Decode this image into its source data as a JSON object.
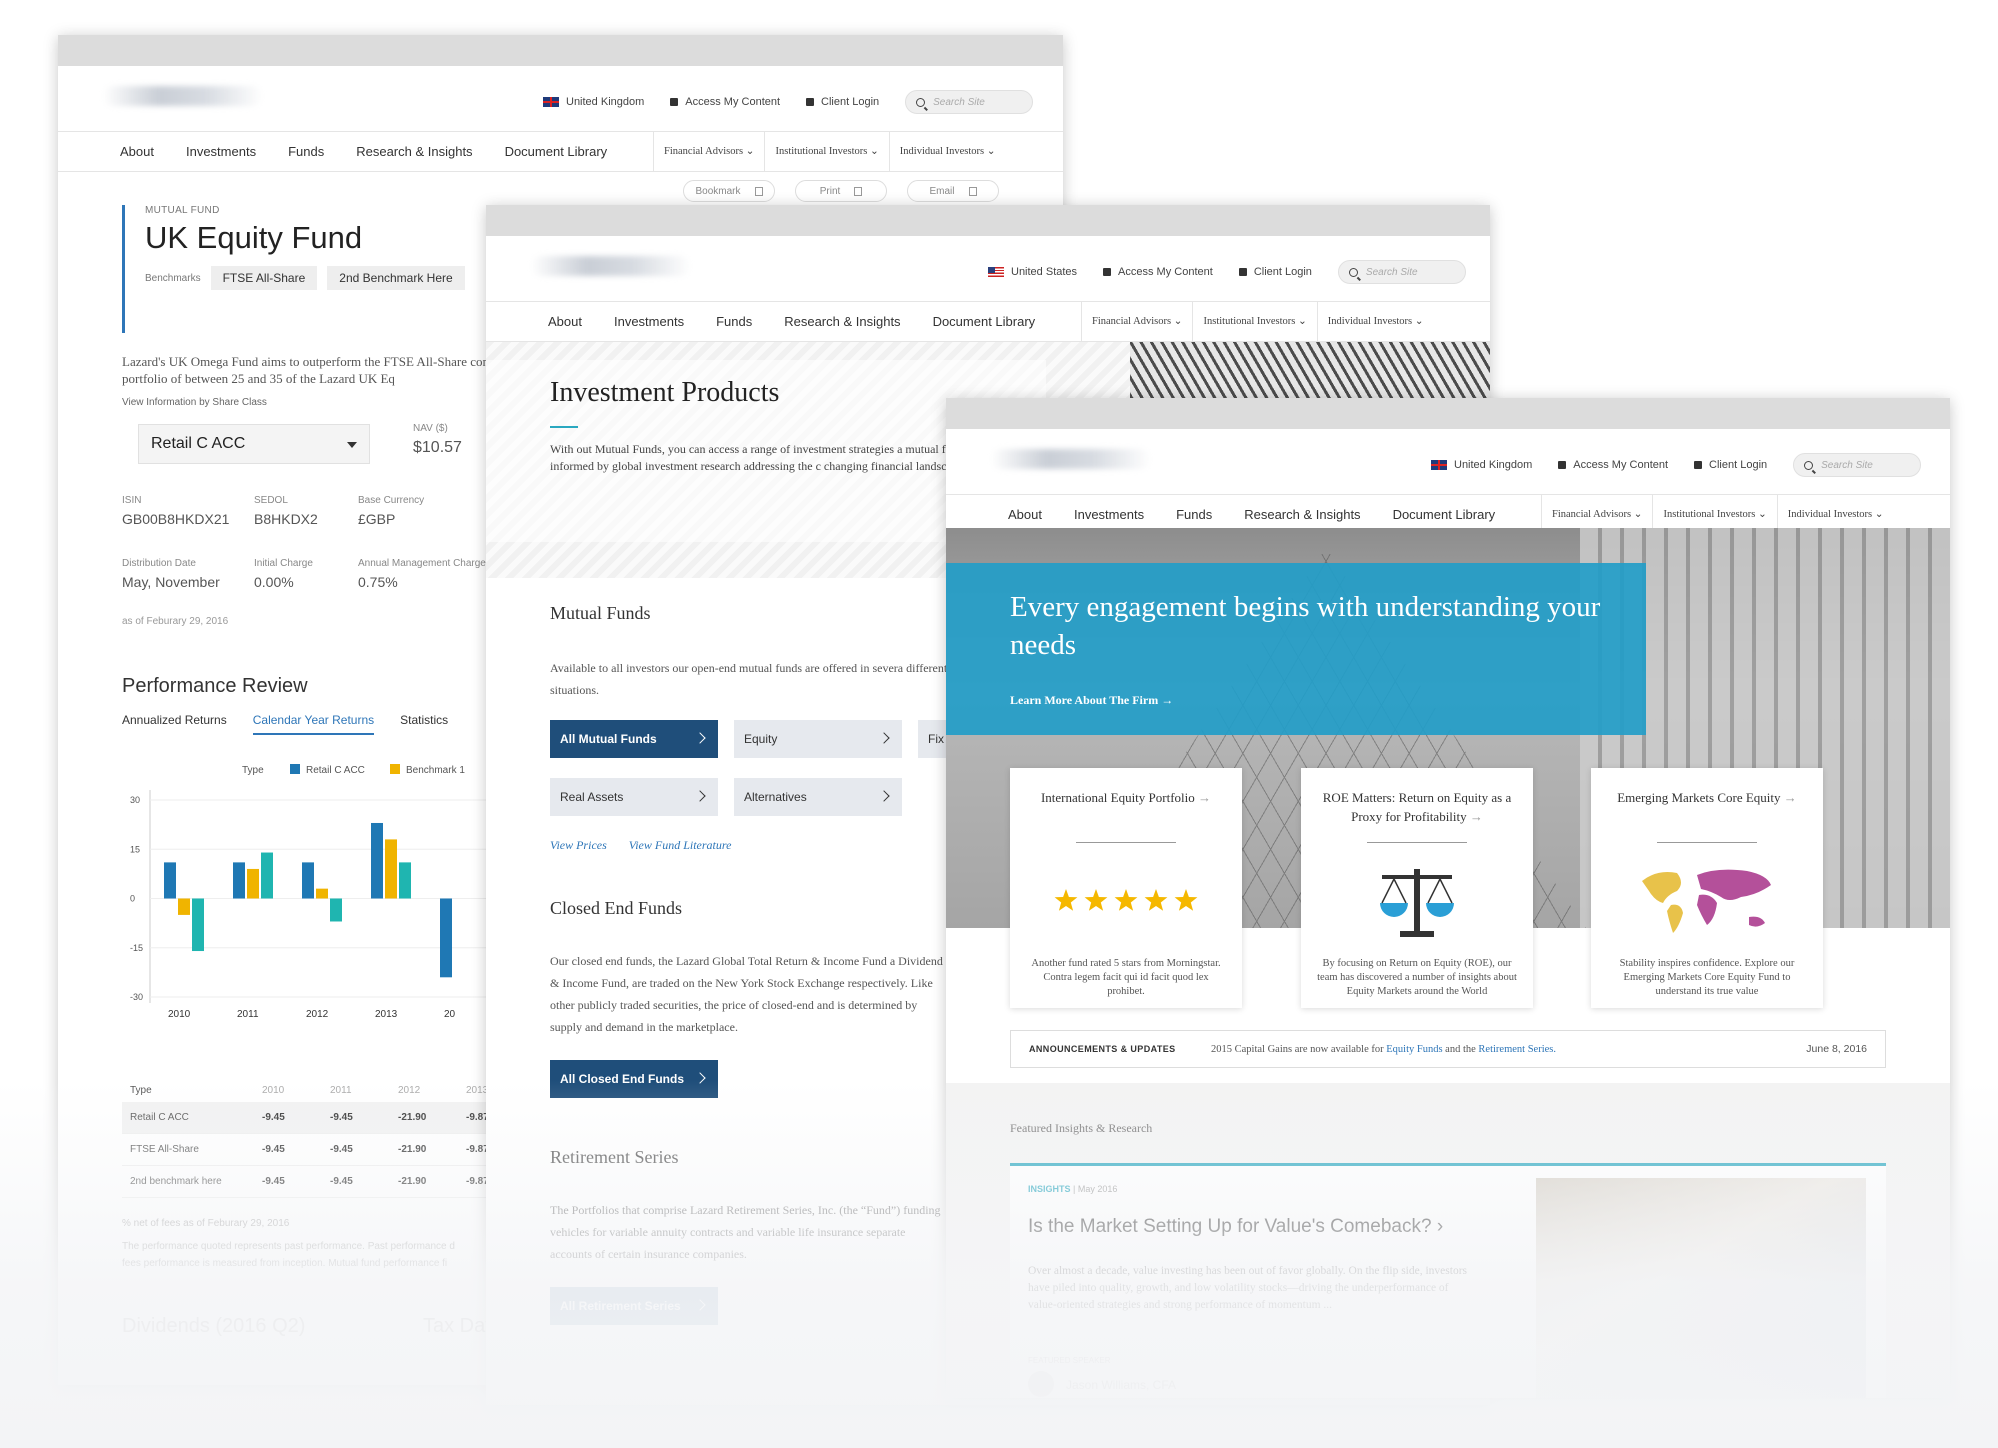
{
  "colors": {
    "accent_blue": "#2e76b8",
    "teal": "#2aa8c0",
    "navy_button": "#1f4e7a",
    "hero_teal": "#239dc8",
    "bar_blue": "#1f78b4",
    "bar_yellow": "#f0b400",
    "bar_teal": "#1fb5b0",
    "star": "#f5b800"
  },
  "w1": {
    "util": {
      "region": "United Kingdom",
      "access": "Access My Content",
      "login": "Client Login",
      "search_placeholder": "Search Site"
    },
    "nav": [
      "About",
      "Investments",
      "Funds",
      "Research & Insights",
      "Document Library"
    ],
    "audiences": [
      "Financial Advisors",
      "Institutional Investors",
      "Individual Investors"
    ],
    "tools": [
      "Bookmark",
      "Print",
      "Email"
    ],
    "kicker": "MUTUAL FUND",
    "title": "UK Equity Fund",
    "bench_label": "Benchmarks",
    "benchmarks": [
      "FTSE All-Share",
      "2nd Benchmark Here"
    ],
    "description": "Lazard's UK Omega Fund aims to outperform the FTSE All-Share concentrated portfolio of between 25 and 35 of the Lazard UK Eq",
    "share_class_label": "View Information by Share Class",
    "share_class_value": "Retail C ACC",
    "nav_label": "NAV ($)",
    "nav_value": "$10.57",
    "facts": [
      {
        "k": "ISIN",
        "v": "GB00B8HKDX21"
      },
      {
        "k": "SEDOL",
        "v": "B8HKDX2"
      },
      {
        "k": "Base Currency",
        "v": "£GBP"
      },
      {
        "k": "Distribution Date",
        "v": "May, November"
      },
      {
        "k": "Initial Charge",
        "v": "0.00%"
      },
      {
        "k": "Annual Management Charge",
        "v": "0.75%"
      }
    ],
    "as_of": "as of Feburary 29, 2016",
    "perf_title": "Performance Review",
    "perf_tabs": [
      "Annualized Returns",
      "Calendar Year Returns",
      "Statistics"
    ],
    "table": {
      "header": [
        "Type",
        "2010",
        "2011",
        "2012",
        "2013"
      ],
      "rows": [
        [
          "Retail C ACC",
          "-9.45",
          "-9.45",
          "-21.90",
          "-9.87"
        ],
        [
          "FTSE All-Share",
          "-9.45",
          "-9.45",
          "-21.90",
          "-9.87"
        ],
        [
          "2nd benchmark here",
          "-9.45",
          "-9.45",
          "-21.90",
          "-9.87"
        ]
      ]
    },
    "foot": [
      "% net of fees as of Feburary 29, 2016",
      "The performance quoted represents past performance. Past performance d",
      "fees performance is measured from inception. Mutual fund performance fi"
    ],
    "dividends": "Dividends (2016 Q2)",
    "tax": "Tax Dat"
  },
  "chart_data": {
    "type": "bar",
    "legend_title": "Type",
    "categories": [
      "2010",
      "2011",
      "2012",
      "2013",
      "20"
    ],
    "series": [
      {
        "name": "Retail C ACC",
        "values": [
          11,
          11,
          11,
          23,
          -24
        ]
      },
      {
        "name": "Benchmark 1",
        "values": [
          -5,
          9,
          3,
          18,
          null
        ]
      },
      {
        "name": "",
        "values": [
          -16,
          14,
          -7,
          11,
          null
        ]
      }
    ],
    "ylim": [
      -30,
      30
    ],
    "yticks": [
      "30",
      "15",
      "0",
      "-15",
      "-30"
    ]
  },
  "w2": {
    "util": {
      "region": "United States",
      "access": "Access My Content",
      "login": "Client Login",
      "search_placeholder": "Search Site"
    },
    "nav": [
      "About",
      "Investments",
      "Funds",
      "Research & Insights",
      "Document Library"
    ],
    "audiences": [
      "Financial Advisors",
      "Institutional Investors",
      "Individual Investors"
    ],
    "title": "Investment Products",
    "description": "With out Mutual Funds, you can access a range of investment strategies a mutual funds are informed by global investment research addressing the c changing financial landscape.",
    "mutual_title": "Mutual Funds",
    "mutual_desc": "Available to all investors our open-end mutual funds are offered in severa different situations.",
    "fund_buttons": [
      "All Mutual Funds",
      "Equity",
      "Fix",
      "Real Assets",
      "Alternatives"
    ],
    "links": [
      "View Prices",
      "View Fund Literature"
    ],
    "closed_title": "Closed End Funds",
    "closed_desc": "Our closed end funds, the Lazard Global Total Return & Income Fund a Dividend & Income Fund, are traded on the New York Stock Exchange respectively. Like other publicly traded securities, the price of closed-end and is determined by supply and demand in the marketplace.",
    "closed_button": "All Closed End Funds",
    "retire_title": "Retirement Series",
    "retire_desc": "The Portfolios that comprise Lazard Retirement Series, Inc. (the “Fund”) funding vehicles for variable annuity contracts and variable life insurance separate accounts of certain insurance companies.",
    "retire_button": "All Retirement Series"
  },
  "w3": {
    "util": {
      "region": "United Kingdom",
      "access": "Access My Content",
      "login": "Client Login",
      "search_placeholder": "Search Site"
    },
    "nav": [
      "About",
      "Investments",
      "Funds",
      "Research & Insights",
      "Document Library"
    ],
    "audiences": [
      "Financial Advisors",
      "Institutional Investors",
      "Individual Investors"
    ],
    "hero_title": "Every engagement begins with understanding your needs",
    "hero_link": "Learn More About The Firm",
    "cards": [
      {
        "title": "International Equity Portfolio",
        "desc": "Another fund rated 5 stars from Morningstar. Contra legem facit qui id facit quod lex prohibet.",
        "icon": "five-star-rating-icon"
      },
      {
        "title": "ROE Matters: Return on Equity as a Proxy for Profitability",
        "desc": "By focusing on Return on Equity (ROE), our team has discovered a number of insights about Equity Markets around the World",
        "icon": "balance-scale-icon"
      },
      {
        "title": "Emerging Markets Core Equity",
        "desc": "Stability inspires confidence. Explore our Emerging Markets Core Equity Fund to understand its true value",
        "icon": "world-map-icon"
      }
    ],
    "rating": 5,
    "announce_label": "ANNOUNCEMENTS & UPDATES",
    "announce_pre": "2015 Capital Gains are now available for",
    "announce_link1": "Equity Funds",
    "announce_mid": "and the",
    "announce_link2": "Retirement Series.",
    "announce_date": "June 8, 2016",
    "featured_title": "Featured Insights & Research",
    "insight_kicker": "INSIGHTS",
    "insight_date": "| May 2016",
    "insight_title": "Is the Market Setting Up for Value's Comeback?",
    "insight_desc": "Over almost a decade, value investing has been out of favor globally. On the flip side, investors have piled into quality, growth, and low volatility stocks—driving the underperformance of value-oriented strategies and strong performance of momentum ...",
    "speaker_label": "FEATURED SPEAKER",
    "speaker_name": "Jason Williams, CFA"
  }
}
